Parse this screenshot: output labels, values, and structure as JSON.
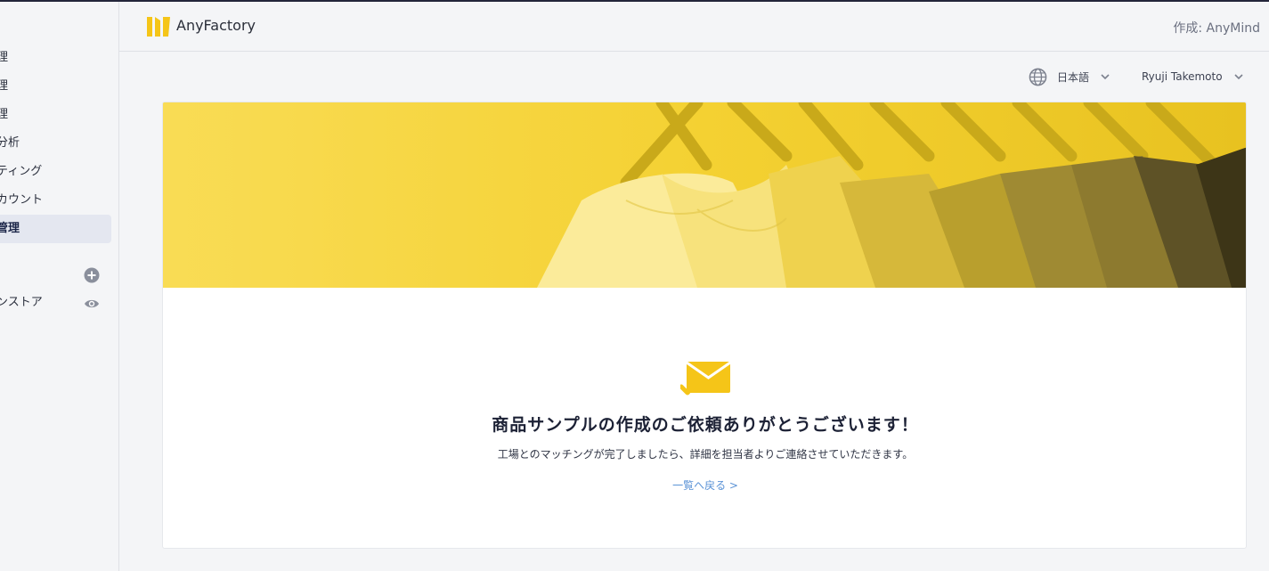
{
  "sidebar": {
    "items": [
      {
        "label": "理"
      },
      {
        "label": "理"
      },
      {
        "label": "理"
      },
      {
        "label": "分析"
      },
      {
        "label": "ティング"
      },
      {
        "label": "カウント"
      },
      {
        "label": "管理"
      }
    ],
    "store_label": "ンストア"
  },
  "header": {
    "app_title": "AnyFactory",
    "maker": "作成: AnyMind"
  },
  "toolbar": {
    "language": "日本語",
    "user_name": "Ryuji Takemoto"
  },
  "confirmation": {
    "title": "商品サンプルの作成のご依頼ありがとうございます！",
    "message": "工場とのマッチングが完了しましたら、詳細を担当者よりご連絡させていただきます。",
    "back_link": "一覧へ戻る >"
  },
  "colors": {
    "brand_yellow": "#f5cc1f",
    "link_blue": "#5a92d6",
    "active_nav_bg": "#e4e7f0"
  },
  "icons": [
    "logo-icon",
    "plus-circle-icon",
    "eye-icon",
    "globe-icon",
    "chevron-down-icon",
    "mail-check-icon"
  ]
}
